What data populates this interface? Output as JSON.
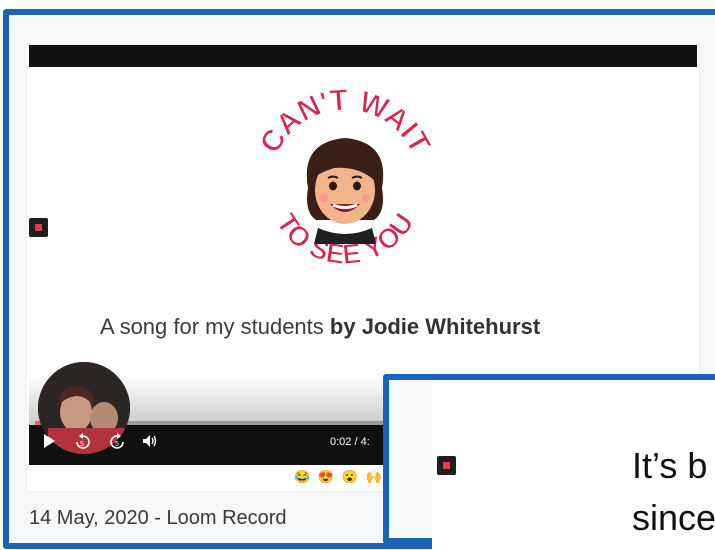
{
  "video": {
    "title_art_top": "CAN'T WAIT",
    "title_art_bottom": "TO SEE YOU",
    "subtitle_plain": "A song for my students ",
    "subtitle_bold": "by Jodie Whitehurst",
    "time_display": "0:02 / 4:",
    "progress_fraction": 0.03,
    "reactions": [
      "😂",
      "😍",
      "😮",
      "🙌"
    ],
    "caption": "14 May, 2020 - Loom Record"
  },
  "controls": {
    "play_icon": "play-icon",
    "rewind_icon": "rewind-5-icon",
    "forward_icon": "forward-5-icon",
    "volume_icon": "volume-icon"
  },
  "front_card": {
    "line1": "It’s b",
    "line2": "since"
  },
  "colors": {
    "frame_border": "#1a64b4",
    "record_red": "#e8384f",
    "progress": "#f05a6b",
    "title_pink": "#d7264f"
  }
}
